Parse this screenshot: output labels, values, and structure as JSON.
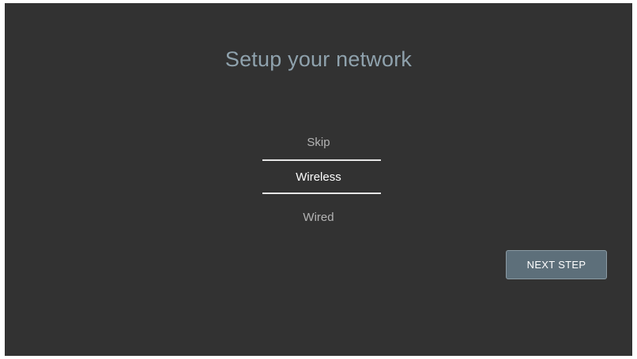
{
  "title": "Setup your network",
  "options": [
    {
      "label": "Skip",
      "selected": false
    },
    {
      "label": "Wireless",
      "selected": true
    },
    {
      "label": "Wired",
      "selected": false
    }
  ],
  "next_button": {
    "label": "NEXT STEP"
  },
  "colors": {
    "background": "#323232",
    "title": "#8fa2ad",
    "selected_text": "#ffffff",
    "unselected_text": "#b4b4b4",
    "button": "#5d6f7a"
  }
}
